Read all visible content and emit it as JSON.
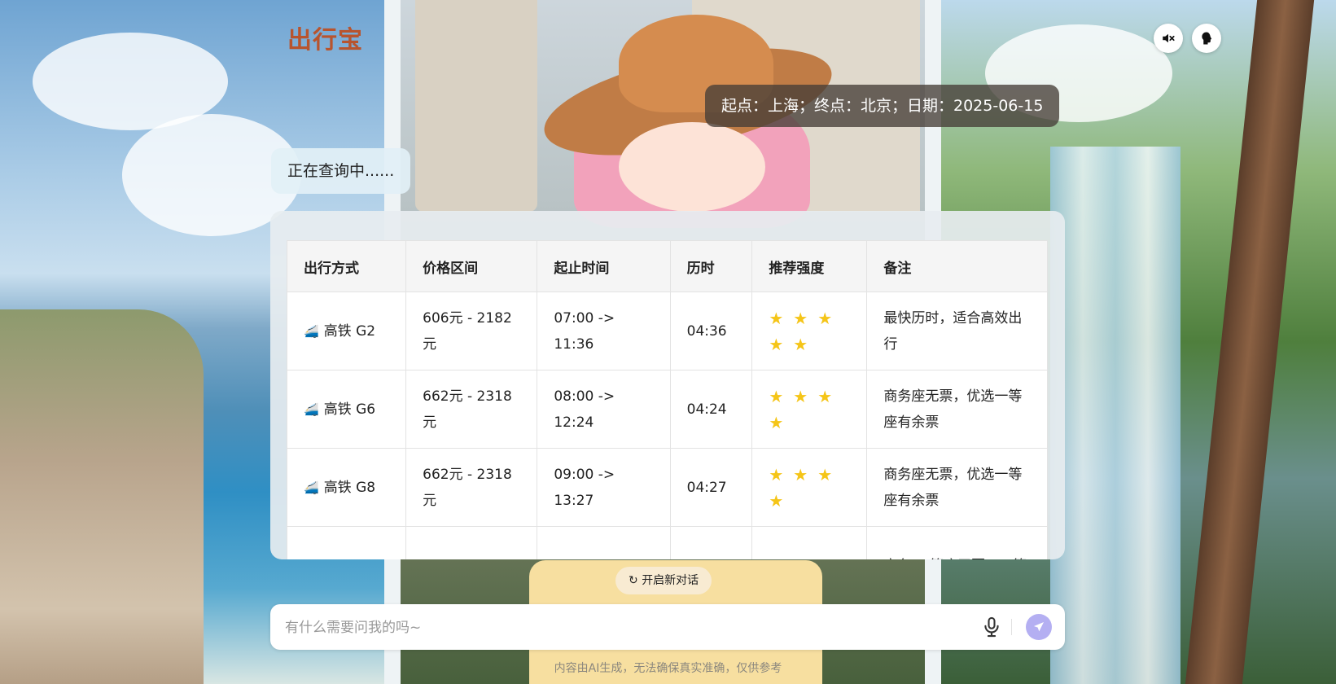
{
  "app": {
    "title": "出行宝"
  },
  "header": {
    "mute_icon": "speaker-muted-icon",
    "voice_icon": "head-profile-icon"
  },
  "chat": {
    "user_message": "起点：上海；终点：北京；日期：2025-06-15",
    "bot_status": "正在查询中......"
  },
  "table": {
    "headers": [
      "出行方式",
      "价格区间",
      "起止时间",
      "历时",
      "推荐强度",
      "备注"
    ],
    "rows": [
      {
        "mode": "高铁 G2",
        "price": "606元 - 2182元",
        "time": "07:00 -> 11:36",
        "duration": "04:36",
        "stars": "★★★★★",
        "note": "最快历时，适合高效出行"
      },
      {
        "mode": "高铁 G6",
        "price": "662元 - 2318元",
        "time": "08:00 -> 12:24",
        "duration": "04:24",
        "stars": "★★★★",
        "note": "商务座无票，优选一等座有余票"
      },
      {
        "mode": "高铁 G8",
        "price": "662元 - 2318元",
        "time": "09:00 -> 13:27",
        "duration": "04:27",
        "stars": "★★★★",
        "note": "商务座无票，优选一等座有余票"
      },
      {
        "mode": "",
        "price": "",
        "time": "",
        "duration": "",
        "stars": "★★★",
        "note": "商务/一等座无票，二等"
      }
    ],
    "row_icon": "train-icon",
    "star_color": "#f5c518"
  },
  "actions": {
    "new_chat": "开启新对话"
  },
  "input": {
    "placeholder": "有什么需要问我的吗~",
    "value": "",
    "mic_icon": "microphone-icon",
    "send_icon": "send-arrow-icon"
  },
  "footer": {
    "disclaimer": "内容由AI生成，无法确保真实准确，仅供参考"
  },
  "colors": {
    "brand": "#b8542e",
    "send": "#b4aff2",
    "bubble_dark": "#463e37"
  }
}
